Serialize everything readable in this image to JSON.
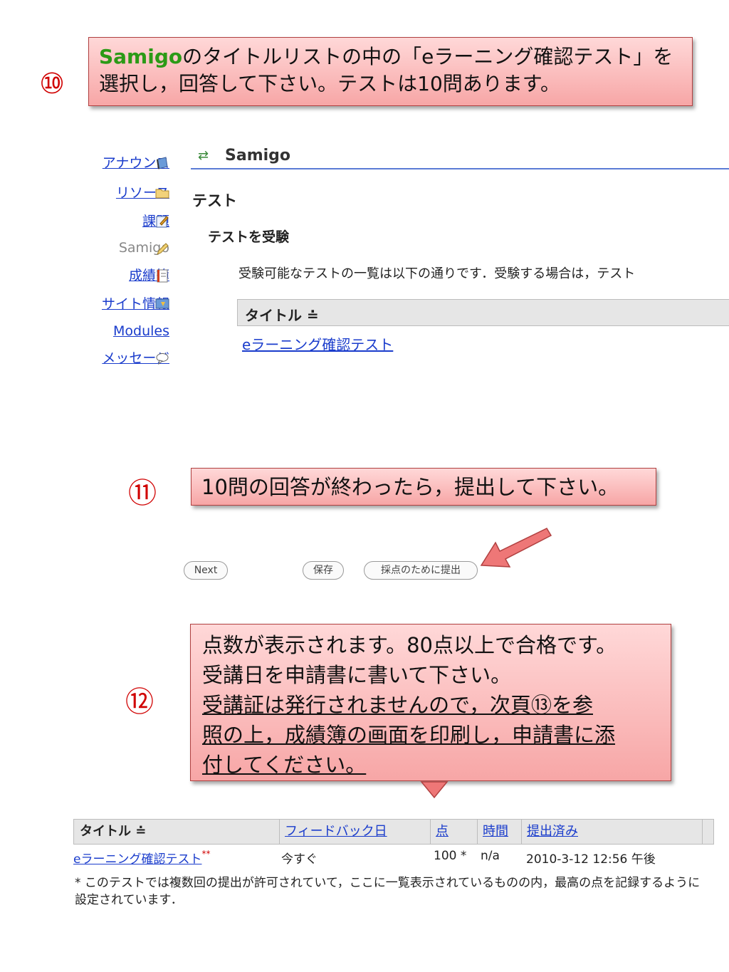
{
  "steps": {
    "s10": {
      "num": "⑩",
      "app": "Samigo",
      "line1_rest": "のタイトルリストの中の「eラーニング確認テスト」を",
      "line2": "選択し，回答して下さい。テストは10問あります。"
    },
    "s11": {
      "num": "⑪",
      "text": "10問の回答が終わったら，提出して下さい。"
    },
    "s12": {
      "num": "⑫",
      "line1": "点数が表示されます。80点以上で合格です。",
      "line2": "受講日を申請書に書いて下さい。",
      "line3": "受講証は発行されませんので，次頁⑬を参",
      "line4": "照の上，成績簿の画面を印刷し，申請書に添",
      "line5": "付してください。"
    }
  },
  "sidebar": {
    "items": [
      {
        "label": "アナウンス",
        "icon": "announcement-icon"
      },
      {
        "label": "リソース",
        "icon": "folder-icon"
      },
      {
        "label": "課題",
        "icon": "assignment-icon"
      },
      {
        "label": "Samigo",
        "icon": "pencil-icon"
      },
      {
        "label": "成績簿",
        "icon": "gradebook-icon"
      },
      {
        "label": "サイト情報",
        "icon": "site-info-icon"
      },
      {
        "label": "Modules",
        "icon": ""
      },
      {
        "label": "メッセージ",
        "icon": "message-icon"
      }
    ]
  },
  "main": {
    "tool_title": "Samigo",
    "heading": "テスト",
    "subheading": "テストを受験",
    "description": "受験可能なテストの一覧は以下の通りです．受験する場合は，テスト",
    "table_header": "タイトル ≐",
    "test_link": "eラーニング確認テスト"
  },
  "buttons": {
    "next": "Next",
    "save": "保存",
    "submit": "採点のために提出"
  },
  "results": {
    "headers": [
      "タイトル ≐",
      "フィードバック日",
      "点",
      "時間",
      "提出済み"
    ],
    "row": {
      "title": "eラーニング確認テスト",
      "marker": "**",
      "feedback": "今すぐ",
      "score": "100 *",
      "time": "n/a",
      "submitted": "2010-3-12 12:56 午後"
    },
    "note": "* このテストでは複数回の提出が許可されていて，ここに一覧表示されているものの内，最高の点を記録するように設定されています．"
  },
  "colors": {
    "callout_fill": "#f7a6a6",
    "step_number": "#d00000",
    "link": "#1a3ccc",
    "samigo_green": "#2b9a16"
  }
}
